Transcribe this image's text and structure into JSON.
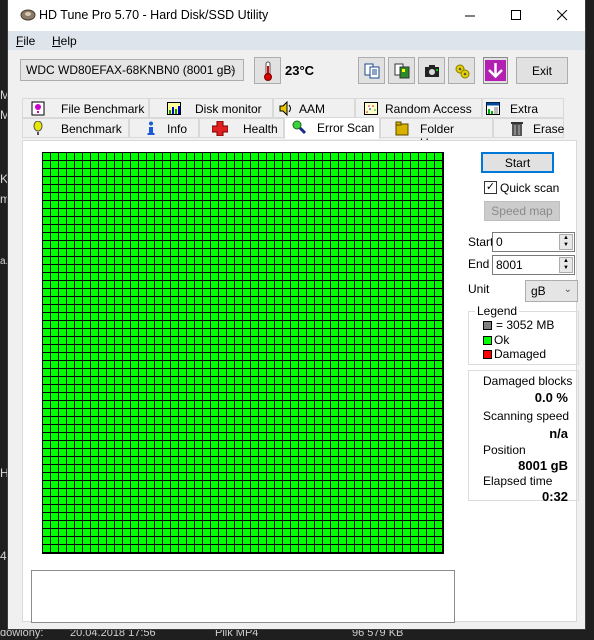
{
  "background": {
    "side_chars": [
      "M",
      "M",
      "K",
      "m",
      "a.r",
      "H",
      "4"
    ],
    "bottom_row": [
      "dowiony:",
      "20.04.2018 17:56",
      "Plik MP4",
      "96 579 KB"
    ]
  },
  "window": {
    "title": "HD Tune Pro 5.70 - Hard Disk/SSD Utility",
    "controls": {
      "minimize": "minimize",
      "maximize": "maximize",
      "close": "close"
    }
  },
  "menu": {
    "items": [
      {
        "label": "File",
        "accel": "F",
        "rest": "ile"
      },
      {
        "label": "Help",
        "accel": "H",
        "rest": "elp"
      }
    ]
  },
  "toolbar": {
    "drive": "WDC WD80EFAX-68KNBN0 (8001 gB)",
    "temperature": "23°C",
    "buttons": [
      "copy-text",
      "copy-screenshot",
      "save-screenshot",
      "options",
      "download"
    ],
    "exit_label": "Exit"
  },
  "tabs": {
    "row1": [
      {
        "label": "File Benchmark",
        "icon": "file-benchmark-icon"
      },
      {
        "label": "Disk monitor",
        "icon": "disk-monitor-icon"
      },
      {
        "label": "AAM",
        "icon": "speaker-icon"
      },
      {
        "label": "Random Access",
        "icon": "random-access-icon"
      },
      {
        "label": "Extra tests",
        "icon": "extra-tests-icon"
      }
    ],
    "row2": [
      {
        "label": "Benchmark",
        "icon": "benchmark-icon"
      },
      {
        "label": "Info",
        "icon": "info-icon"
      },
      {
        "label": "Health",
        "icon": "health-cross-icon"
      },
      {
        "label": "Error Scan",
        "icon": "magnifier-icon",
        "active": true
      },
      {
        "label": "Folder Usage",
        "icon": "folder-icon"
      },
      {
        "label": "Erase",
        "icon": "trash-icon"
      }
    ]
  },
  "error_scan": {
    "grid": {
      "columns": 50,
      "rows": 50,
      "ok_blocks": 2500,
      "damaged_blocks": 0
    },
    "colors": {
      "ok": "#00ff00",
      "damaged": "#ff0000",
      "unscanned": "#808080"
    },
    "start_button": "Start",
    "quick_scan_label": "Quick scan",
    "quick_scan_checked": true,
    "speed_map_button": "Speed map",
    "start_label": "Start",
    "start_value": "0",
    "end_label": "End",
    "end_value": "8001",
    "unit_label": "Unit",
    "unit_value": "gB",
    "legend": {
      "title": "Legend",
      "block_size": "= 3052 MB",
      "ok": "Ok",
      "damaged": "Damaged"
    },
    "stats": {
      "damaged_blocks_label": "Damaged blocks",
      "damaged_blocks_value": "0.0 %",
      "scanning_speed_label": "Scanning speed",
      "scanning_speed_value": "n/a",
      "position_label": "Position",
      "position_value": "8001 gB",
      "elapsed_label": "Elapsed time",
      "elapsed_value": "0:32"
    },
    "log": ""
  }
}
